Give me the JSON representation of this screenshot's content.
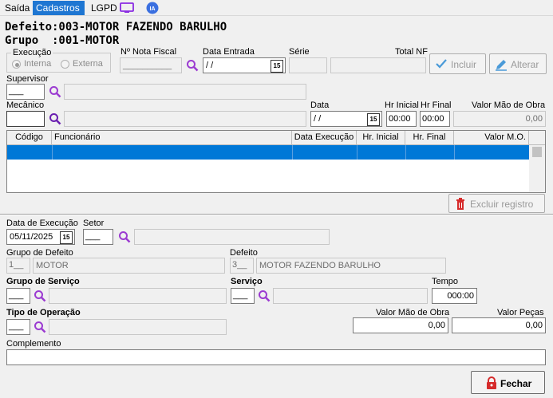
{
  "tabs": [
    "Saída",
    "Cadastros",
    "LGPD"
  ],
  "header": {
    "defeito": "Defeito:003-MOTOR FAZENDO BARULHO",
    "grupo": "Grupo  :001-MOTOR"
  },
  "execucao": {
    "label": "Execução",
    "opt1": "Interna",
    "opt2": "Externa",
    "selected": "Interna"
  },
  "nota_fiscal": {
    "label": "Nº Nota Fiscal",
    "value": "__________"
  },
  "data_entrada": {
    "label": "Data Entrada",
    "value": " / /"
  },
  "serie": {
    "label": "Série",
    "value": ""
  },
  "total_nf": {
    "label": "Total NF",
    "value": ""
  },
  "buttons": {
    "incluir": "Incluir",
    "alterar": "Alterar",
    "excluir": "Excluir registro",
    "fechar": "Fechar"
  },
  "supervisor": {
    "label": "Supervisor",
    "code": "___",
    "name": ""
  },
  "mecanico": {
    "label": "Mecânico",
    "code": "",
    "name": ""
  },
  "data": {
    "label": "Data",
    "value": " / /"
  },
  "hr_inicial": {
    "label": "Hr Inicial",
    "value": "00:00"
  },
  "hr_final": {
    "label": "Hr Final",
    "value": "00:00"
  },
  "valor_mao_obra_top": {
    "label": "Valor Mão de Obra",
    "value": "0,00"
  },
  "grid": {
    "columns": [
      "Código",
      "Funcionário",
      "Data Execução",
      "Hr. Inicial",
      "Hr. Final",
      "Valor M.O."
    ],
    "rows": []
  },
  "data_execucao": {
    "label": "Data de Execução",
    "value": "05/11/2025"
  },
  "setor": {
    "label": "Setor",
    "code": "___",
    "name": ""
  },
  "grupo_defeito": {
    "label": "Grupo de Defeito",
    "code": "1__",
    "name": "MOTOR"
  },
  "defeito": {
    "label": "Defeito",
    "code": "3__",
    "name": "MOTOR FAZENDO BARULHO"
  },
  "grupo_servico": {
    "label": "Grupo de Serviço",
    "code": "___",
    "name": ""
  },
  "servico": {
    "label": "Serviço",
    "code": "___",
    "name": ""
  },
  "tempo": {
    "label": "Tempo",
    "value": "000:00"
  },
  "tipo_operacao": {
    "label": "Tipo de Operação",
    "code": "___",
    "name": ""
  },
  "valor_mao_obra": {
    "label": "Valor Mão de Obra",
    "value": "0,00"
  },
  "valor_pecas": {
    "label": "Valor Peças",
    "value": "0,00"
  },
  "complemento": {
    "label": "Complemento",
    "value": ""
  },
  "colors": {
    "tab_active": "#1e76d2",
    "selection": "#0078d7",
    "magnifier": "#9b3bd1",
    "danger": "#d62b2b"
  }
}
